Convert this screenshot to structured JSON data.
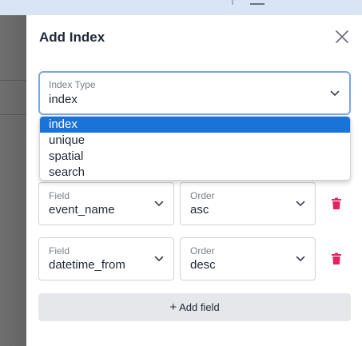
{
  "panel": {
    "title": "Add Index",
    "close_icon": "close-icon"
  },
  "index_type": {
    "label": "Index Type",
    "value": "index",
    "options": [
      "index",
      "unique",
      "spatial",
      "search"
    ],
    "selected_index": 0
  },
  "fields": [
    {
      "field_label": "Field",
      "field_value": "event_name",
      "order_label": "Order",
      "order_value": "asc",
      "delete_icon": "trash-icon"
    },
    {
      "field_label": "Field",
      "field_value": "datetime_from",
      "order_label": "Order",
      "order_value": "desc",
      "delete_icon": "trash-icon"
    }
  ],
  "add_button": {
    "icon": "plus-icon",
    "label": "Add field"
  },
  "colors": {
    "accent": "#1a73d9",
    "focus_border": "#7aa6e8",
    "delete": "#e0245e",
    "button_bg": "#e5e7ea"
  }
}
